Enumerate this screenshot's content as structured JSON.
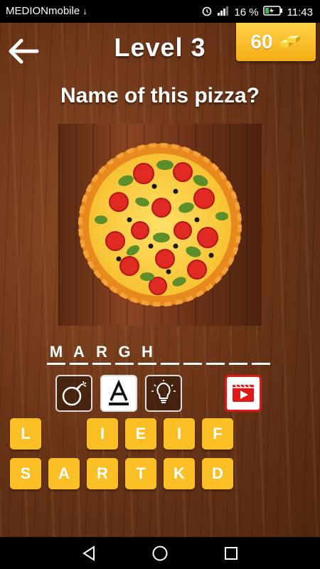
{
  "status": {
    "carrier": "MEDIONmobile",
    "battery": "16 %",
    "time": "11:43"
  },
  "header": {
    "title": "Level 3",
    "coins": "60"
  },
  "question": "Name of this pizza?",
  "answer": {
    "slots": [
      "M",
      "A",
      "R",
      "G",
      "H",
      "",
      "",
      "",
      "",
      "",
      ""
    ]
  },
  "tools": [
    "bomb-icon",
    "letter-hint-icon",
    "lightbulb-icon",
    "video-icon"
  ],
  "letters": {
    "row1": [
      "L",
      "",
      "I",
      "E",
      "I",
      "F"
    ],
    "row2": [
      "S",
      "A",
      "R",
      "T",
      "K",
      "D"
    ]
  },
  "colors": {
    "tile": "#fbbf26",
    "coin_box": "#f4ad14",
    "video_red": "#e01818"
  }
}
